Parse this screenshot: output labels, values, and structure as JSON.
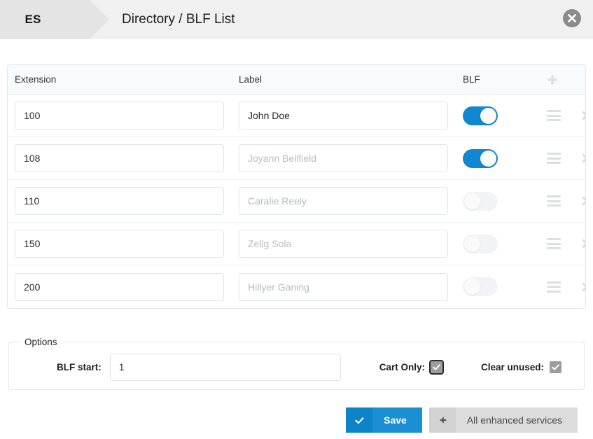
{
  "header": {
    "brand": "ES",
    "title": "Directory / BLF List",
    "close_icon": "close-circle-icon"
  },
  "table": {
    "columns": {
      "extension": "Extension",
      "label": "Label",
      "blf": "BLF",
      "add_icon": "plus-icon"
    },
    "row_icons": {
      "drag": "drag-handle-icon",
      "remove": "remove-x-icon"
    },
    "rows": [
      {
        "extension": "100",
        "label_value": "John Doe",
        "label_placeholder": "",
        "blf_on": true
      },
      {
        "extension": "108",
        "label_value": "",
        "label_placeholder": "Joyann Bellfield",
        "blf_on": true
      },
      {
        "extension": "110",
        "label_value": "",
        "label_placeholder": "Caralie Reely",
        "blf_on": false
      },
      {
        "extension": "150",
        "label_value": "",
        "label_placeholder": "Zelig Sola",
        "blf_on": false
      },
      {
        "extension": "200",
        "label_value": "",
        "label_placeholder": "Hillyer Ganing",
        "blf_on": false
      }
    ]
  },
  "options": {
    "legend": "Options",
    "blf_start_label": "BLF start:",
    "blf_start_value": "1",
    "cart_only_label": "Cart Only:",
    "cart_only_checked": true,
    "clear_unused_label": "Clear unused:",
    "clear_unused_checked": true
  },
  "footer": {
    "save_label": "Save",
    "save_icon": "check-icon",
    "back_label": "All enhanced services",
    "back_icon": "arrow-left-icon"
  },
  "colors": {
    "accent": "#1a8fd4",
    "toggle_on": "#1187d2",
    "toggle_off": "#f2f3f4",
    "header_bg": "#f0f0f0",
    "brand_bg": "#e4e4e4"
  }
}
